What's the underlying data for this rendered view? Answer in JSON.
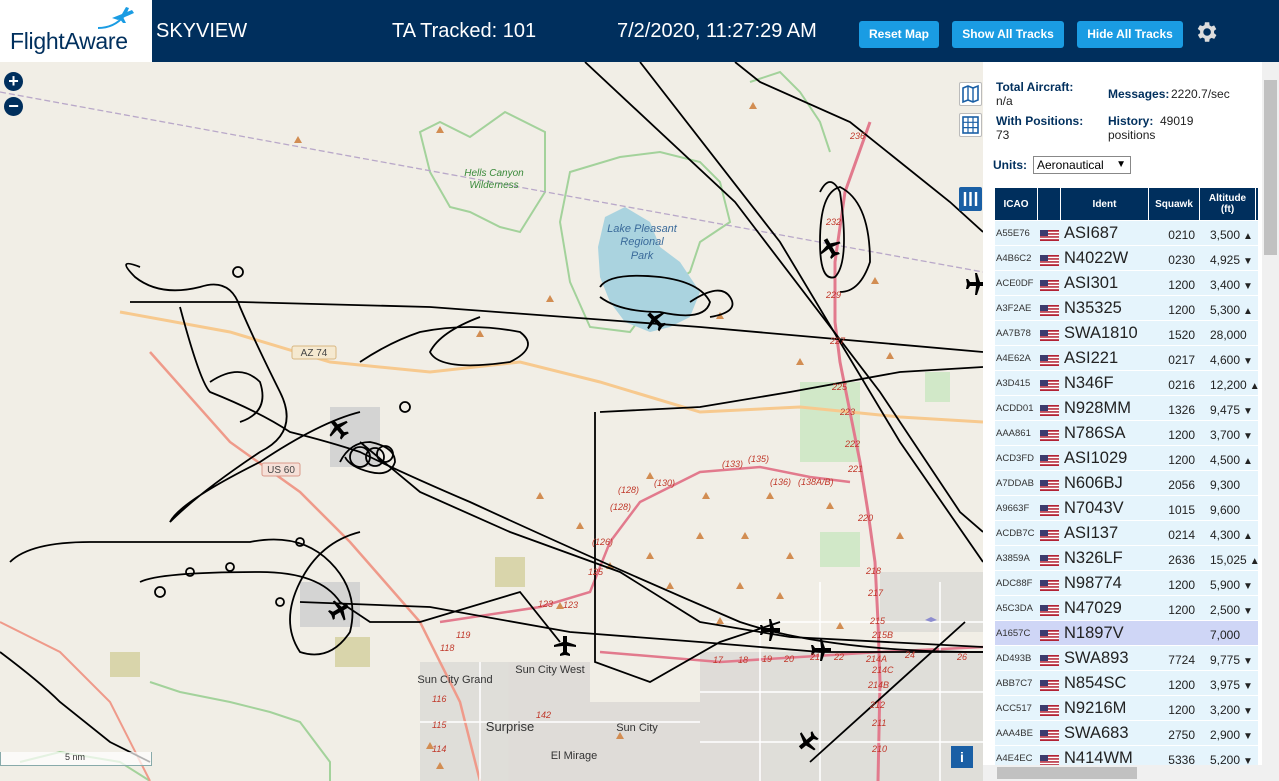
{
  "header": {
    "logo": "FlightAware",
    "app_title": "SKYVIEW",
    "tracked": "TA Tracked: 101",
    "clock": "7/2/2020, 11:27:29 AM",
    "buttons": {
      "reset": "Reset Map",
      "show": "Show All Tracks",
      "hide": "Hide All Tracks"
    }
  },
  "map": {
    "zoom_in": "+",
    "zoom_out": "−",
    "scale": "5 nm",
    "info": "i",
    "labels": {
      "hells_canyon": [
        "Hells Canyon",
        "Wilderness"
      ],
      "lake_pleasant": [
        "Lake Pleasant",
        "Regional",
        "Park"
      ],
      "az74": "AZ 74",
      "us60": "US 60",
      "sun_city_west": "Sun City West",
      "sun_city_grand": "Sun City Grand",
      "surprise": "Surprise",
      "sun_city": "Sun City",
      "el_mirage": "El Mirage"
    },
    "exits": [
      "236",
      "232",
      "229",
      "227",
      "225",
      "223",
      "222",
      "221",
      "220",
      "218",
      "217",
      "215",
      "215B",
      "214C",
      "214B",
      "214A",
      "212",
      "211",
      "210",
      "(130)",
      "(133)",
      "(135)",
      "(136)",
      "(138A/B)",
      "(128)",
      "(128)",
      "(126)",
      "125",
      "123",
      "123",
      "119",
      "118",
      "116",
      "115",
      "114",
      "17",
      "18",
      "19",
      "20",
      "21",
      "22",
      "24",
      "26",
      "142"
    ]
  },
  "panel": {
    "total_aircraft_label": "Total Aircraft:",
    "total_aircraft_value": "n/a",
    "with_positions_label": "With Positions:",
    "with_positions_value": "73",
    "messages_label": "Messages:",
    "messages_value": "2220.7/sec",
    "history_label": "History:",
    "history_value": "49019",
    "history_unit": "positions",
    "units_label": "Units:",
    "units_value": "Aeronautical",
    "columns": {
      "icao": "ICAO",
      "ident": "Ident",
      "squawk": "Squawk",
      "altitude": "Altitude",
      "altitude_unit": "(ft)"
    },
    "rows": [
      {
        "icao": "A55E76",
        "ident": "ASI687",
        "squawk": "0210",
        "alt": "3,500",
        "trend": "▲"
      },
      {
        "icao": "A4B6C2",
        "ident": "N4022W",
        "squawk": "0230",
        "alt": "4,925",
        "trend": "▼"
      },
      {
        "icao": "ACE0DF",
        "ident": "ASI301",
        "squawk": "1200",
        "alt": "3,400",
        "trend": "▼"
      },
      {
        "icao": "A3F2AE",
        "ident": "N35325",
        "squawk": "1200",
        "alt": "5,300",
        "trend": "▲"
      },
      {
        "icao": "AA7B78",
        "ident": "SWA1810",
        "squawk": "1520",
        "alt": "28,000",
        "trend": ""
      },
      {
        "icao": "A4E62A",
        "ident": "ASI221",
        "squawk": "0217",
        "alt": "4,600",
        "trend": "▼"
      },
      {
        "icao": "A3D415",
        "ident": "N346F",
        "squawk": "0216",
        "alt": "12,200",
        "trend": "▲"
      },
      {
        "icao": "ACDD01",
        "ident": "N928MM",
        "squawk": "1326",
        "alt": "9,475",
        "trend": "▼"
      },
      {
        "icao": "AAA861",
        "ident": "N786SA",
        "squawk": "1200",
        "alt": "3,700",
        "trend": "▼"
      },
      {
        "icao": "ACD3FD",
        "ident": "ASI1029",
        "squawk": "1200",
        "alt": "4,500",
        "trend": "▲"
      },
      {
        "icao": "A7DDAB",
        "ident": "N606BJ",
        "squawk": "2056",
        "alt": "9,300",
        "trend": ""
      },
      {
        "icao": "A9663F",
        "ident": "N7043V",
        "squawk": "1015",
        "alt": "9,600",
        "trend": ""
      },
      {
        "icao": "ACDB7C",
        "ident": "ASI137",
        "squawk": "0214",
        "alt": "4,300",
        "trend": "▲"
      },
      {
        "icao": "A3859A",
        "ident": "N326LF",
        "squawk": "2636",
        "alt": "15,025",
        "trend": "▲"
      },
      {
        "icao": "ADC88F",
        "ident": "N98774",
        "squawk": "1200",
        "alt": "5,900",
        "trend": "▼"
      },
      {
        "icao": "A5C3DA",
        "ident": "N47029",
        "squawk": "1200",
        "alt": "2,500",
        "trend": "▼"
      },
      {
        "icao": "A1657C",
        "ident": "N1897V",
        "squawk": "",
        "alt": "7,000",
        "trend": "",
        "selected": true
      },
      {
        "icao": "AD493B",
        "ident": "SWA893",
        "squawk": "7724",
        "alt": "9,775",
        "trend": "▼"
      },
      {
        "icao": "ABB7C7",
        "ident": "N854SC",
        "squawk": "1200",
        "alt": "3,975",
        "trend": "▼"
      },
      {
        "icao": "ACC517",
        "ident": "N9216M",
        "squawk": "1200",
        "alt": "3,200",
        "trend": "▼"
      },
      {
        "icao": "AAA4BE",
        "ident": "SWA683",
        "squawk": "2750",
        "alt": "2,900",
        "trend": "▼"
      },
      {
        "icao": "A4E4EC",
        "ident": "N414WM",
        "squawk": "5336",
        "alt": "5,200",
        "trend": "▼"
      }
    ]
  },
  "colors": {
    "header": "#002f5d",
    "button": "#1a9ce3",
    "row": "#e5f4fc",
    "row_selected": "#cfd6f6",
    "map_bg": "#f1eee6"
  }
}
